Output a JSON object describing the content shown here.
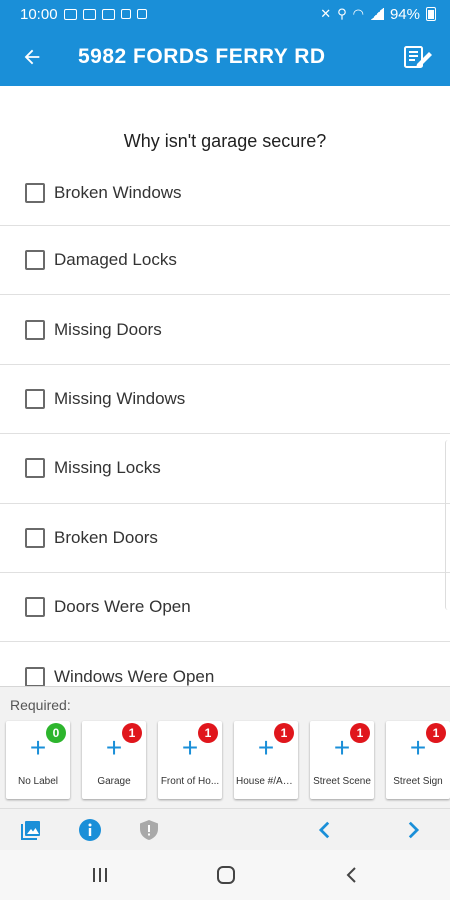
{
  "status_bar": {
    "time": "10:00",
    "battery": "94%"
  },
  "app_bar": {
    "title": "5982 FORDS FERRY RD",
    "back_icon": "arrow-left-icon",
    "edit_icon": "edit-note-icon"
  },
  "form": {
    "question": "Why isn't garage secure?",
    "options": [
      {
        "label": "Broken Windows",
        "checked": false
      },
      {
        "label": "Damaged Locks",
        "checked": false
      },
      {
        "label": "Missing Doors",
        "checked": false
      },
      {
        "label": "Missing Windows",
        "checked": false
      },
      {
        "label": "Missing Locks",
        "checked": false
      },
      {
        "label": "Broken Doors",
        "checked": false
      },
      {
        "label": "Doors Were Open",
        "checked": false
      },
      {
        "label": "Windows Were Open",
        "checked": false
      }
    ]
  },
  "required": {
    "label": "Required:",
    "tiles": [
      {
        "label": "No Label",
        "count": "0",
        "badge_color": "#2db52d"
      },
      {
        "label": "Garage",
        "count": "1",
        "badge_color": "#e0161c"
      },
      {
        "label": "Front of Ho...",
        "count": "1",
        "badge_color": "#e0161c"
      },
      {
        "label": "House #/Ad...",
        "count": "1",
        "badge_color": "#e0161c"
      },
      {
        "label": "Street Scene",
        "count": "1",
        "badge_color": "#e0161c"
      },
      {
        "label": "Street Sign",
        "count": "1",
        "badge_color": "#e0161c"
      }
    ]
  },
  "bottom_toolbar": {
    "icons": [
      "gallery-icon",
      "info-icon",
      "shield-icon",
      "chevron-left-icon",
      "chevron-right-icon"
    ]
  },
  "colors": {
    "primary": "#1a8fd8",
    "badge_green": "#2db52d",
    "badge_red": "#e0161c"
  }
}
